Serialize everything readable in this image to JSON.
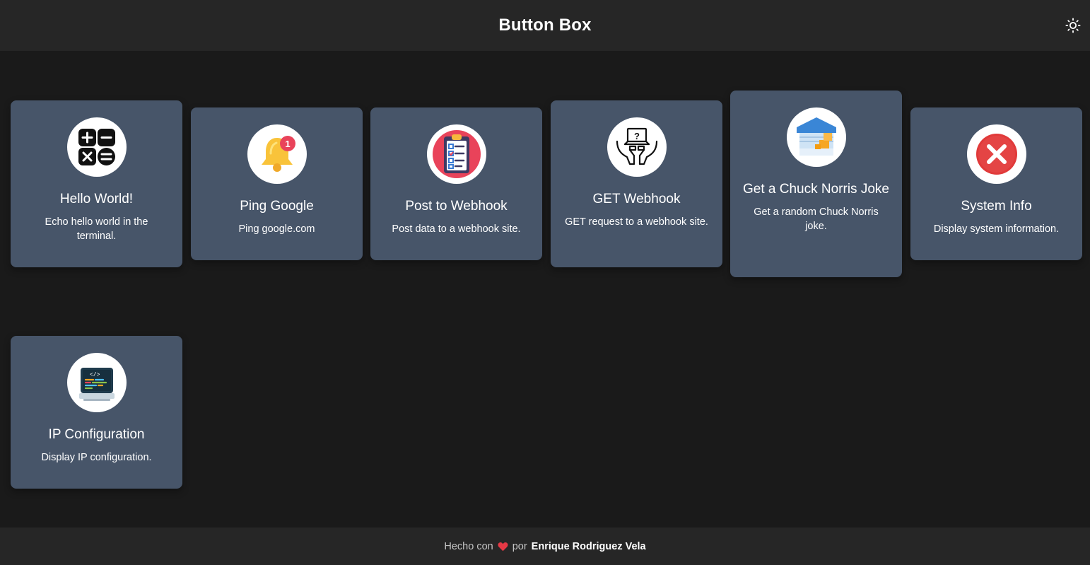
{
  "header": {
    "title": "Button Box",
    "theme_toggle_icon": "sun-icon"
  },
  "buttons": [
    {
      "title": "Hello World!",
      "description": "Echo hello world in the terminal.",
      "icon": "calculator-icon"
    },
    {
      "title": "Ping Google",
      "description": "Ping google.com",
      "icon": "notification-bell-icon",
      "badge": "1"
    },
    {
      "title": "Post to Webhook",
      "description": "Post data to a webhook site.",
      "icon": "clipboard-checklist-icon"
    },
    {
      "title": "GET Webhook",
      "description": "GET request to a webhook site.",
      "icon": "hands-laptop-question-icon"
    },
    {
      "title": "Get a Chuck Norris Joke",
      "description": "Get a random Chuck Norris joke.",
      "icon": "warehouse-box-icon"
    },
    {
      "title": "System Info",
      "description": "Display system information.",
      "icon": "close-circle-icon"
    },
    {
      "title": "IP Configuration",
      "description": "Display IP configuration.",
      "icon": "code-monitor-icon"
    }
  ],
  "footer": {
    "prefix": "Hecho con",
    "heart_icon": "heart-icon",
    "middle": "por",
    "author": "Enrique Rodriguez Vela"
  },
  "colors": {
    "background": "#1a1a1a",
    "bar": "#262626",
    "card": "#475569",
    "heart": "#e53945"
  }
}
